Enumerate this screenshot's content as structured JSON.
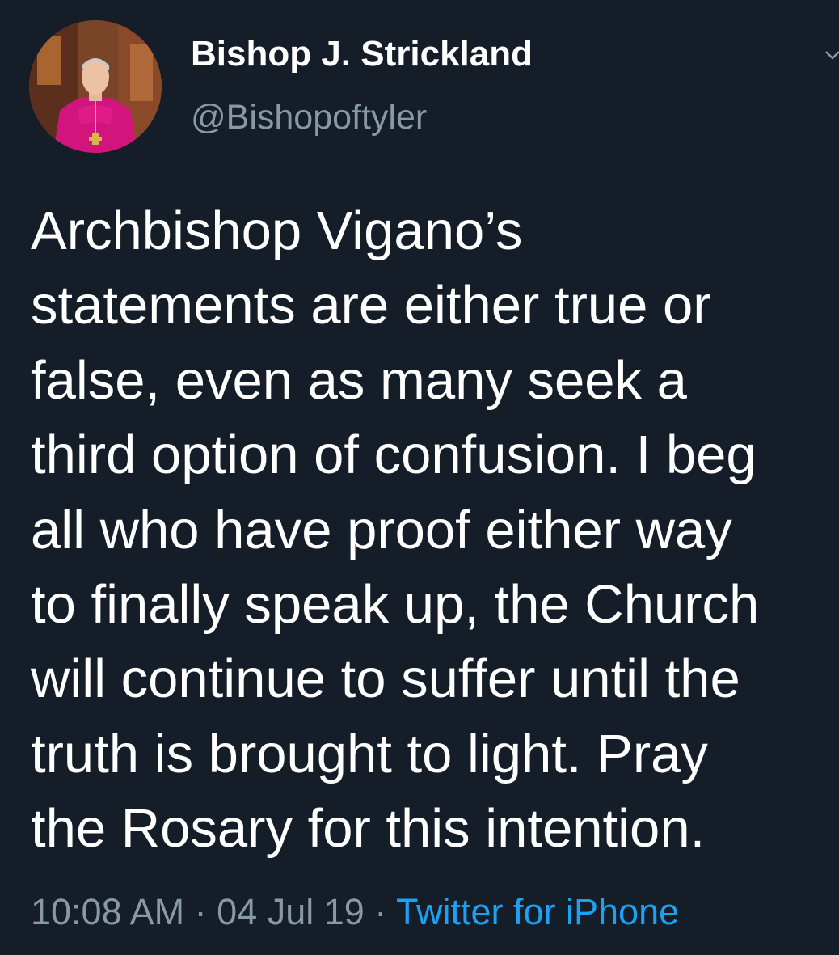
{
  "user": {
    "display_name": "Bishop J. Strickland",
    "handle": "@Bishopoftyler",
    "avatar_icon": "profile-photo"
  },
  "tweet": {
    "text": "Archbishop Vigano’s\nstatements are either true or\nfalse, even as many seek a\nthird option of confusion. I beg\nall who have proof either way\nto finally speak up, the Church\nwill continue to suffer until the\ntruth is brought to light. Pray\nthe Rosary for this intention.",
    "time": "10:08 AM",
    "separator_1": " · ",
    "date": "04 Jul 19",
    "separator_2": " · ",
    "source": "Twitter for iPhone"
  },
  "icons": {
    "menu": "chevron-down-icon"
  },
  "colors": {
    "background": "#141d28",
    "text": "#ffffff",
    "muted": "#8899a6",
    "link": "#1da1f2"
  }
}
